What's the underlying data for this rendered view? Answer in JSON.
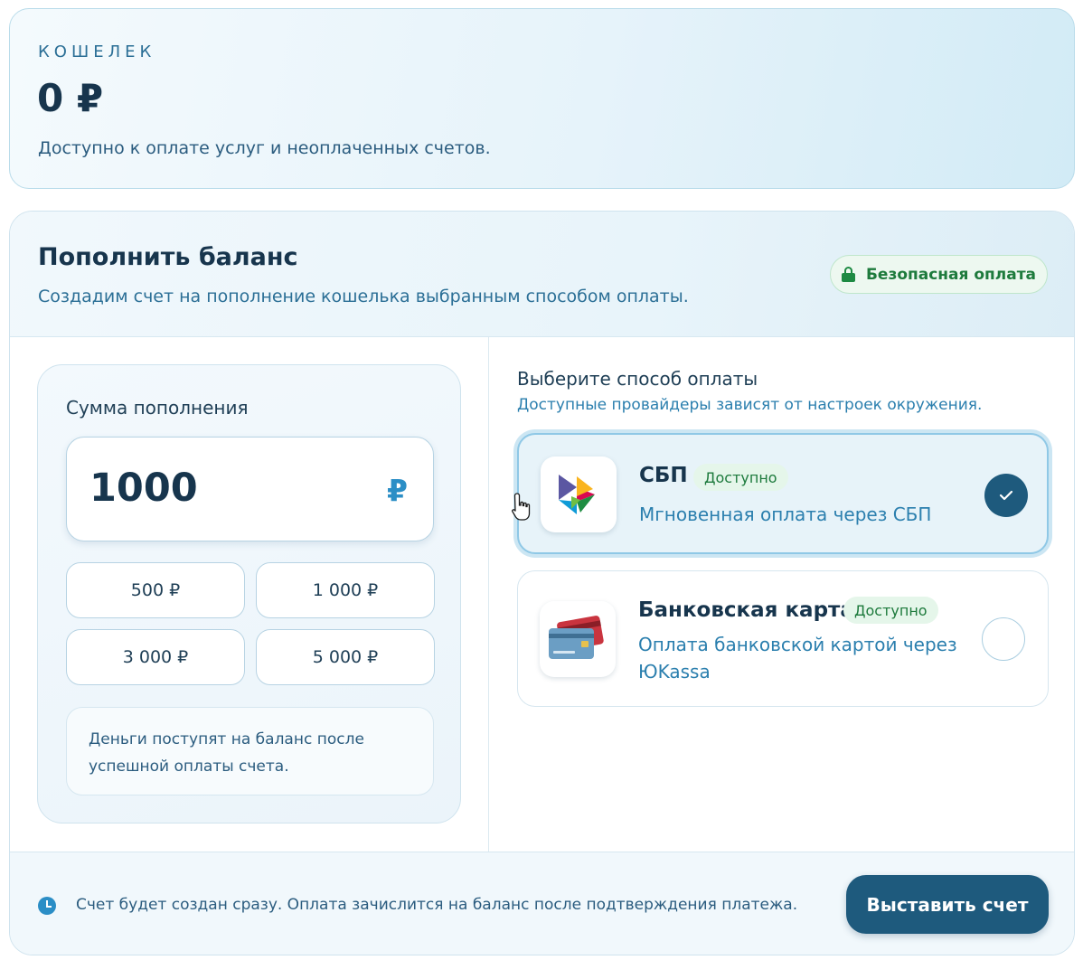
{
  "wallet": {
    "label": "КОШЕЛЕК",
    "amount": "0 ₽",
    "description": "Доступно к оплате услуг и неоплаченных счетов."
  },
  "topup": {
    "title": "Пополнить баланс",
    "subtitle": "Создадим счет на пополнение кошелька выбранным способом оплаты.",
    "secure_badge": "Безопасная оплата",
    "amount": {
      "label": "Сумма пополнения",
      "value": "1000",
      "currency": "₽",
      "presets": [
        "500 ₽",
        "1 000 ₽",
        "3 000 ₽",
        "5 000 ₽"
      ],
      "note": "Деньги поступят на баланс после успешной оплаты счета."
    },
    "methods": {
      "title": "Выберите способ оплаты",
      "subtitle": "Доступные провайдеры зависят от настроек окружения.",
      "items": [
        {
          "name": "СБП",
          "status": "Доступно",
          "description": "Мгновенная оплата через СБП",
          "selected": true,
          "icon": "sbp-logo-icon"
        },
        {
          "name": "Банковская карта",
          "status": "Доступно",
          "description": "Оплата банковской картой через ЮKassa",
          "selected": false,
          "icon": "bank-cards-icon"
        }
      ]
    },
    "footer": {
      "info": "Счет будет создан сразу. Оплата зачислится на баланс после подтверждения платежа.",
      "submit_label": "Выставить счет"
    }
  },
  "colors": {
    "primary": "#1e5a7d",
    "accent": "#2b8ec6",
    "success": "#1d7a3c",
    "success_bg": "#e5f6ea"
  }
}
